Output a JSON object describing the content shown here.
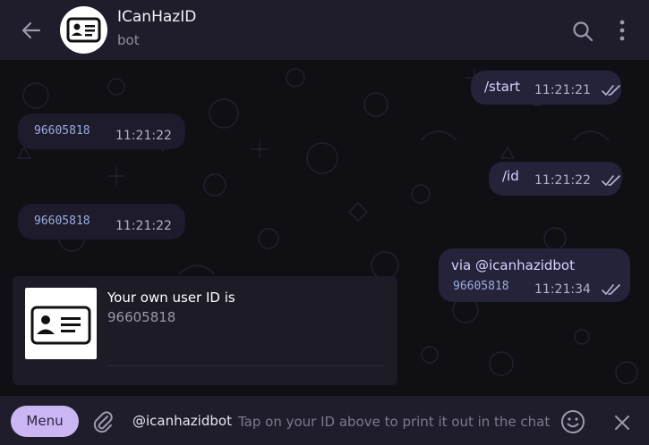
{
  "header": {
    "title": "ICanHazID",
    "subtitle": "bot"
  },
  "messages": [
    {
      "text": "/start",
      "time": "11:21:21"
    },
    {
      "text": "96605818",
      "time": "11:21:22"
    },
    {
      "text": "/id",
      "time": "11:21:22"
    },
    {
      "text": "96605818",
      "time": "11:21:22"
    },
    {
      "text": "via @icanhazidbot",
      "id": "96605818",
      "time": "11:21:34"
    }
  ],
  "card": {
    "title": "Your own user ID is",
    "value": "96605818"
  },
  "input": {
    "menu_label": "Menu",
    "prefix": "@icanhazidbot",
    "placeholder": "Tap on your ID above to print it out in the chat"
  },
  "colors": {
    "accent": "#c9b6f2",
    "header_bg": "#1f1d2b",
    "outgoing_bubble": "#252339",
    "incoming_bubble": "#1e1b2c",
    "link_text": "#d7d3ff",
    "check_marks": "#b8b5d8"
  },
  "icons": [
    "back-arrow-icon",
    "id-card-icon",
    "search-icon",
    "more-vertical-icon",
    "double-check-icon",
    "paperclip-icon",
    "emoji-icon",
    "close-icon"
  ]
}
